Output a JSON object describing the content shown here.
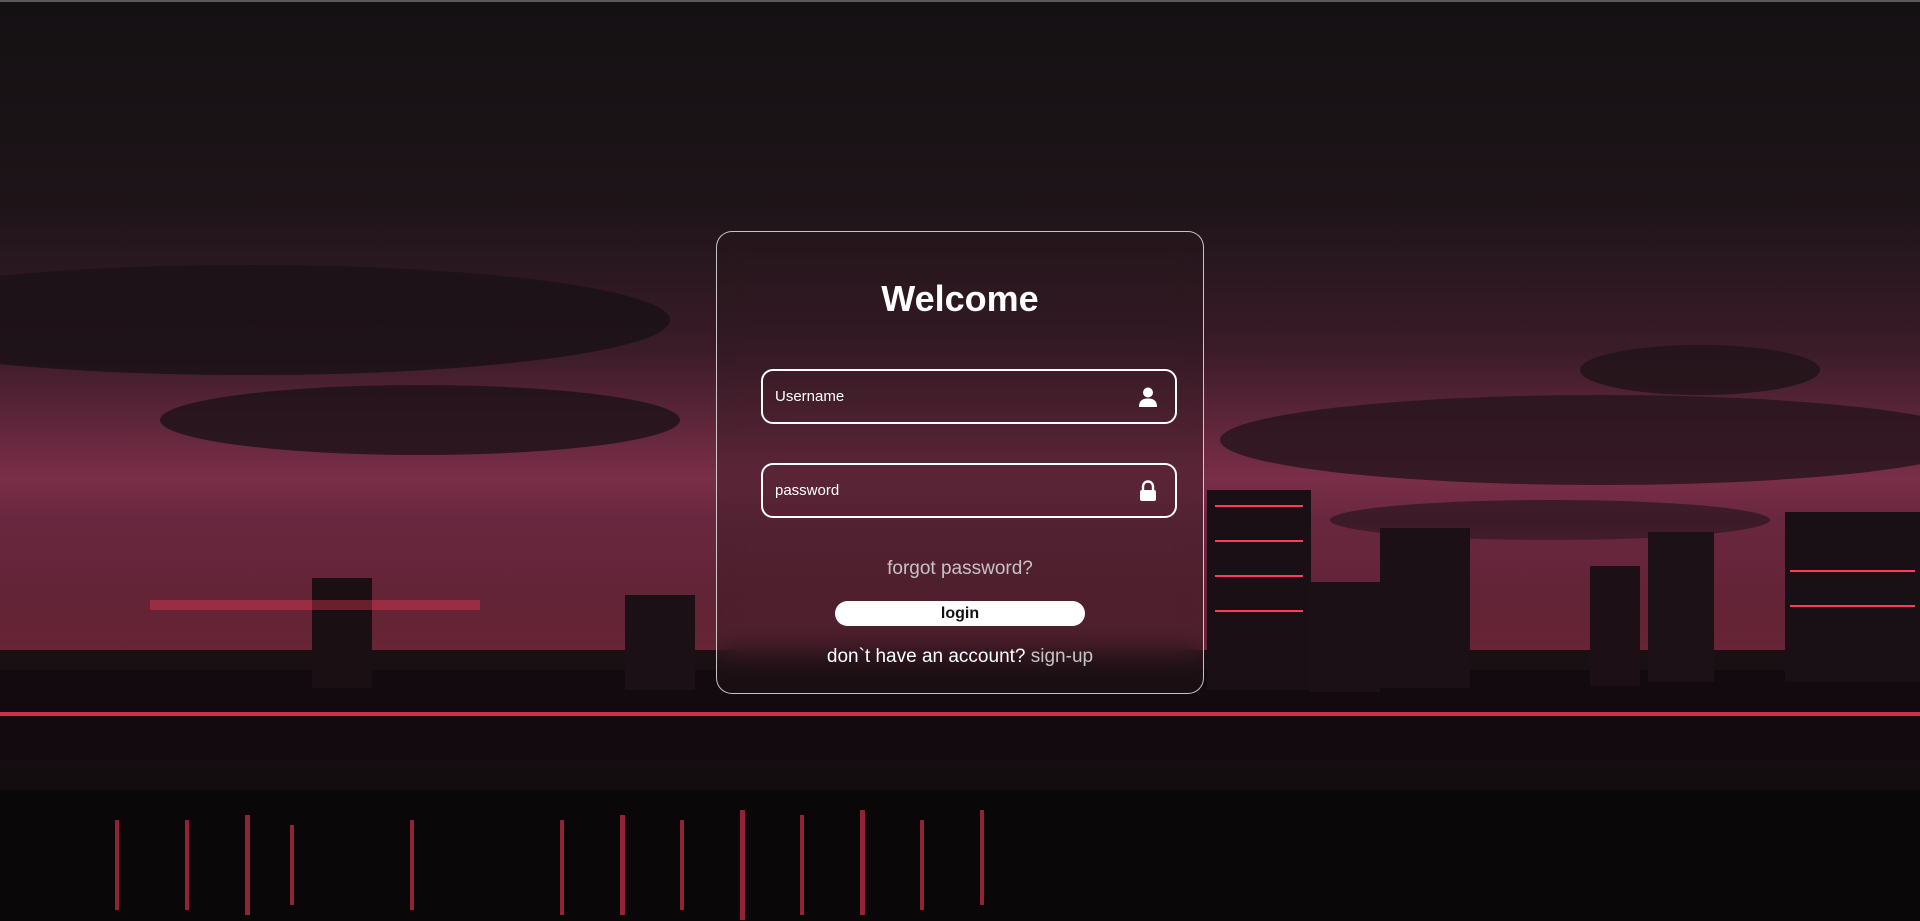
{
  "login_card": {
    "title": "Welcome",
    "username": {
      "placeholder": "Username",
      "value": "",
      "icon": "user-icon"
    },
    "password": {
      "placeholder": "password",
      "value": "",
      "icon": "lock-icon"
    },
    "forgot_password_label": "forgot password?",
    "login_label": "login",
    "signup_prompt": "don`t have an account?",
    "signup_label": "sign-up"
  },
  "colors": {
    "card_border": "#ffffff",
    "button_bg": "#ffffff",
    "muted_text": "#c9c2c5"
  }
}
